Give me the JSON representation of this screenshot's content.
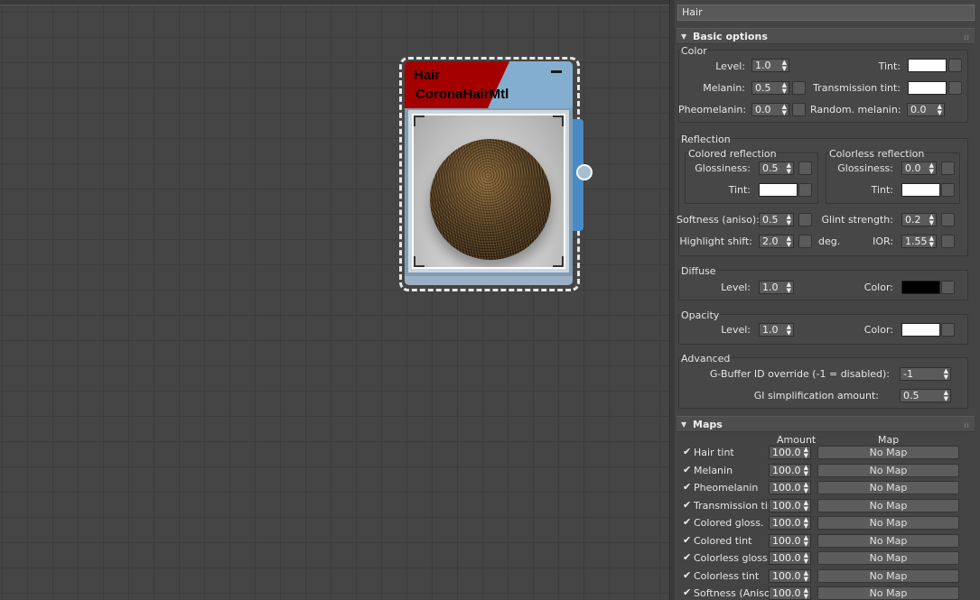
{
  "node": {
    "title": "Hair",
    "type": "CoronaHairMtl"
  },
  "panel": {
    "material_name": "Hair",
    "basic_options": {
      "header": "Basic options",
      "color": {
        "label": "Color",
        "level_label": "Level:",
        "level_value": "1.0",
        "tint_label": "Tint:",
        "tint_color": "#ffffff",
        "melanin_label": "Melanin:",
        "melanin_value": "0.5",
        "transmission_tint_label": "Transmission tint:",
        "transmission_tint_color": "#ffffff",
        "pheomelanin_label": "Pheomelanin:",
        "pheomelanin_value": "0.0",
        "random_melanin_label": "Random. melanin:",
        "random_melanin_value": "0.0"
      },
      "reflection": {
        "label": "Reflection",
        "colored_label": "Colored reflection",
        "colorless_label": "Colorless reflection",
        "glossiness_label": "Glossiness:",
        "colored_glossiness": "0.5",
        "colorless_glossiness": "0.0",
        "tint_label": "Tint:",
        "colored_tint_color": "#ffffff",
        "colorless_tint_color": "#ffffff",
        "softness_label": "Softness (aniso):",
        "softness_value": "0.5",
        "glint_label": "Glint strength:",
        "glint_value": "0.2",
        "highlight_label": "Highlight shift:",
        "highlight_value": "2.0",
        "highlight_unit": "deg.",
        "ior_label": "IOR:",
        "ior_value": "1.55"
      },
      "diffuse": {
        "label": "Diffuse",
        "level_label": "Level:",
        "level_value": "1.0",
        "color_label": "Color:",
        "color": "#000000"
      },
      "opacity": {
        "label": "Opacity",
        "level_label": "Level:",
        "level_value": "1.0",
        "color_label": "Color:",
        "color": "#ffffff"
      },
      "advanced": {
        "label": "Advanced",
        "gbuffer_label": "G-Buffer ID override (-1 = disabled):",
        "gbuffer_value": "-1",
        "gi_label": "GI simplification amount:",
        "gi_value": "0.5"
      }
    },
    "maps": {
      "header": "Maps",
      "col_amount": "Amount",
      "col_map": "Map",
      "rows": [
        {
          "label": "Hair tint",
          "amount": "100.0",
          "map": "No Map"
        },
        {
          "label": "Melanin",
          "amount": "100.0",
          "map": "No Map"
        },
        {
          "label": "Pheomelanin",
          "amount": "100.0",
          "map": "No Map"
        },
        {
          "label": "Transmission tint",
          "amount": "100.0",
          "map": "No Map"
        },
        {
          "label": "Colored gloss.",
          "amount": "100.0",
          "map": "No Map"
        },
        {
          "label": "Colored tint",
          "amount": "100.0",
          "map": "No Map"
        },
        {
          "label": "Colorless gloss.",
          "amount": "100.0",
          "map": "No Map"
        },
        {
          "label": "Colorless tint",
          "amount": "100.0",
          "map": "No Map"
        },
        {
          "label": "Softness (Aniso)",
          "amount": "100.0",
          "map": "No Map"
        }
      ]
    }
  }
}
